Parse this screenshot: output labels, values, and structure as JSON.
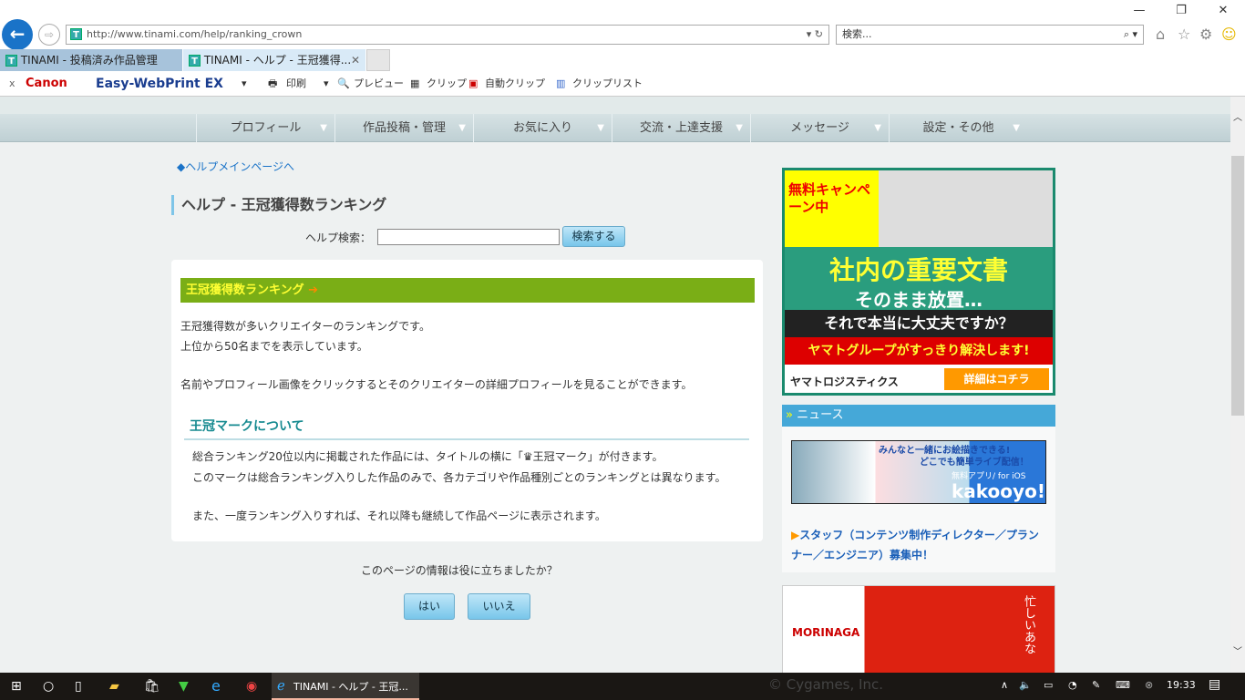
{
  "browser": {
    "url": "http://www.tinami.com/help/ranking_crown",
    "search_placeholder": "検索...",
    "tabs": [
      {
        "label": "TINAMI - 投稿済み作品管理"
      },
      {
        "label": "TINAMI - ヘルプ - 王冠獲得..."
      }
    ],
    "toolbar": {
      "close": "x",
      "canon": "Canon",
      "ewp": "Easy-WebPrint EX",
      "print": "印刷",
      "preview": "プレビュー",
      "clip": "クリップ",
      "auto_clip": "自動クリップ",
      "clip_list": "クリップリスト"
    }
  },
  "nav": [
    "プロフィール",
    "作品投稿・管理",
    "お気に入り",
    "交流・上達支援",
    "メッセージ",
    "設定・その他"
  ],
  "main": {
    "back_link": "ヘルプメインページへ",
    "title": "ヘルプ - 王冠獲得数ランキング",
    "search_label": "ヘルプ検索：",
    "search_value": "",
    "search_button": "検索する",
    "section_title": "王冠獲得数ランキング",
    "para1": "王冠獲得数が多いクリエイターのランキングです。",
    "para2": "上位から50名までを表示しています。",
    "para3": "名前やプロフィール画像をクリックするとそのクリエイターの詳細プロフィールを見ることができます。",
    "sub_title": "王冠マークについて",
    "sub1": "総合ランキング20位以内に掲載された作品には、タイトルの横に「♛王冠マーク」が付きます。",
    "sub2": "このマークは総合ランキング入りした作品のみで、各カテゴリや作品種別ごとのランキングとは異なります。",
    "sub3": "また、一度ランキング入りすれば、それ以降も継続して作品ページに表示されます。",
    "feedback_q": "このページの情報は役に立ちましたか？",
    "yes": "はい",
    "no": "いいえ"
  },
  "sidebar": {
    "ad": {
      "badge": "無料キャンペーン中",
      "line1": "社内の重要文書",
      "line2": "そのまま放置…",
      "line3": "それで本当に大丈夫ですか？",
      "line4": "ヤマトグループがすっきり解決します!",
      "brand": "ヤマトロジスティクス",
      "cta": "詳細はコチラ"
    },
    "news_header": "ニュース",
    "banner": {
      "line1": "みんなと一緒にお絵描きできる!",
      "line2": "どこでも簡単ライブ配信！",
      "line3": "無料アプリ/ for iOS",
      "logo": "kakooyo!"
    },
    "news_item": "スタッフ（コンテンツ制作ディレクター／プランナー／エンジニア）募集中！",
    "ad2_brand": "MORINAGA",
    "ad2_text": "忙しいあな"
  },
  "taskbar": {
    "active_window": "TINAMI - ヘルプ - 王冠...",
    "clock": "19:33",
    "wallpaper_text": "© Cygames, Inc."
  }
}
